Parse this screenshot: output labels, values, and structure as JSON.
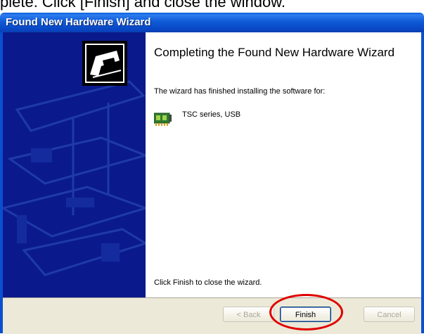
{
  "instruction": "plete. Click [Finish] and close the window.",
  "window": {
    "title": "Found New Hardware Wizard"
  },
  "content": {
    "heading": "Completing the Found New Hardware Wizard",
    "subtext": "The wizard has finished installing the software for:",
    "device_name": "TSC series, USB",
    "finish_text": "Click Finish to close the wizard."
  },
  "buttons": {
    "back": "< Back",
    "finish": "Finish",
    "cancel": "Cancel"
  },
  "icons": {
    "wizard": "hardware-wizard-icon",
    "device": "circuit-board-icon"
  },
  "colors": {
    "title_bar": "#0a4fd0",
    "side_panel": "#0a1a8c",
    "highlight": "#e00000"
  }
}
